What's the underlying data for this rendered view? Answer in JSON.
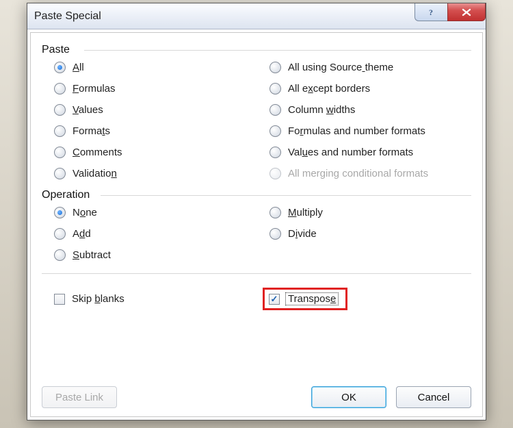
{
  "title": "Paste Special",
  "groups": {
    "paste": {
      "label": "Paste",
      "items_left": [
        {
          "text": "All",
          "u": 0,
          "selected": true,
          "name": "radio-all"
        },
        {
          "text": "Formulas",
          "u": 0,
          "selected": false,
          "name": "radio-formulas"
        },
        {
          "text": "Values",
          "u": 0,
          "selected": false,
          "name": "radio-values"
        },
        {
          "text": "Formats",
          "u": 5,
          "selected": false,
          "name": "radio-formats"
        },
        {
          "text": "Comments",
          "u": 0,
          "selected": false,
          "name": "radio-comments"
        },
        {
          "text": "Validation",
          "u": 9,
          "selected": false,
          "name": "radio-validation"
        }
      ],
      "items_right": [
        {
          "text": "All using Source theme",
          "u": 16,
          "selected": false,
          "name": "radio-source-theme"
        },
        {
          "text": "All except borders",
          "u": 5,
          "selected": false,
          "name": "radio-except-borders"
        },
        {
          "text": "Column widths",
          "u": 7,
          "selected": false,
          "name": "radio-column-widths"
        },
        {
          "text": "Formulas and number formats",
          "u": 2,
          "selected": false,
          "name": "radio-formulas-number-formats"
        },
        {
          "text": "Values and number formats",
          "u": 3,
          "selected": false,
          "name": "radio-values-number-formats"
        },
        {
          "text": "All merging conditional formats",
          "u": -1,
          "selected": false,
          "disabled": true,
          "name": "radio-merging-conditional"
        }
      ]
    },
    "operation": {
      "label": "Operation",
      "items_left": [
        {
          "text": "None",
          "u": 1,
          "selected": true,
          "name": "radio-none"
        },
        {
          "text": "Add",
          "u": 1,
          "selected": false,
          "name": "radio-add"
        },
        {
          "text": "Subtract",
          "u": 0,
          "selected": false,
          "name": "radio-subtract"
        }
      ],
      "items_right": [
        {
          "text": "Multiply",
          "u": 0,
          "selected": false,
          "name": "radio-multiply"
        },
        {
          "text": "Divide",
          "u": 1,
          "selected": false,
          "name": "radio-divide"
        }
      ]
    }
  },
  "checks": {
    "skip_blanks": {
      "text": "Skip blanks",
      "u": 5,
      "checked": false
    },
    "transpose": {
      "text": "Transpose",
      "u": 8,
      "checked": true
    }
  },
  "buttons": {
    "paste_link": "Paste Link",
    "ok": "OK",
    "cancel": "Cancel"
  }
}
